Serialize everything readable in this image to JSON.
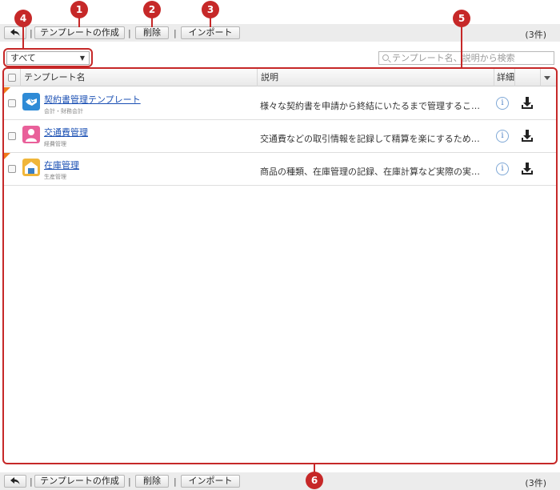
{
  "toolbar": {
    "create_label": "テンプレートの作成",
    "delete_label": "削除",
    "import_label": "インポート",
    "separator": "|",
    "count_label": "(3件)"
  },
  "filter": {
    "selected": "すべて"
  },
  "search": {
    "placeholder": "テンプレート名、説明から検索"
  },
  "table": {
    "headers": {
      "name": "テンプレート名",
      "description": "説明",
      "detail": "詳細"
    },
    "rows": [
      {
        "name": "契約書管理テンプレート",
        "category": "会計・財務会計",
        "description": "様々な契約書を申請から終結にいたるまで管理することので…",
        "icon": "handshake-icon",
        "icon_color": "#2f8bd6"
      },
      {
        "name": "交通費管理",
        "category": "経費管理",
        "description": "交通費などの取引情報を記録して精算を楽にするためのアプ…",
        "icon": "person-icon",
        "icon_color": "#e9609a"
      },
      {
        "name": "在庫管理",
        "category": "生産管理",
        "description": "商品の種類、在庫管理の記録、在庫計算など実際の実務に合…",
        "icon": "warehouse-icon",
        "icon_color": "#f0b63a"
      }
    ]
  },
  "callouts": [
    "1",
    "2",
    "3",
    "4",
    "5",
    "6"
  ],
  "colors": {
    "callout": "#c62828",
    "link": "#1a4fb3",
    "new_corner": "#f07a1a"
  }
}
